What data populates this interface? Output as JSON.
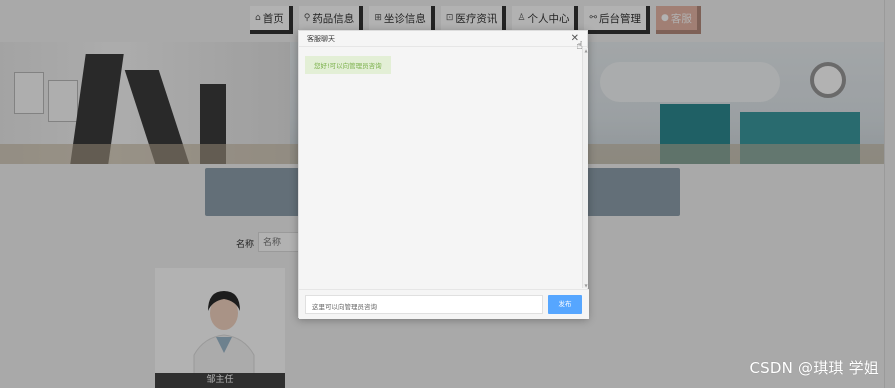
{
  "nav": {
    "items": [
      {
        "icon": "⌂",
        "label": "首页"
      },
      {
        "icon": "⚲",
        "label": "药品信息"
      },
      {
        "icon": "⊞",
        "label": "坐诊信息"
      },
      {
        "icon": "⊡",
        "label": "医疗资讯"
      },
      {
        "icon": "♙",
        "label": "个人中心"
      },
      {
        "icon": "⚯",
        "label": "后台管理"
      },
      {
        "icon": "●",
        "label": "客服"
      }
    ],
    "active_color": "#e7b7a7"
  },
  "search": {
    "label": "名称",
    "placeholder": "名称"
  },
  "doctor": {
    "name": "邹主任"
  },
  "chat": {
    "title": "客服聊天",
    "close_icon": "✕",
    "messages": [
      {
        "text": "您好!可以向管理员咨询",
        "from": "admin"
      }
    ],
    "input_placeholder": "这里可以向管理员咨询",
    "send_label": "发布",
    "send_color": "#56a6ff"
  },
  "watermark": "CSDN @琪琪 学姐"
}
